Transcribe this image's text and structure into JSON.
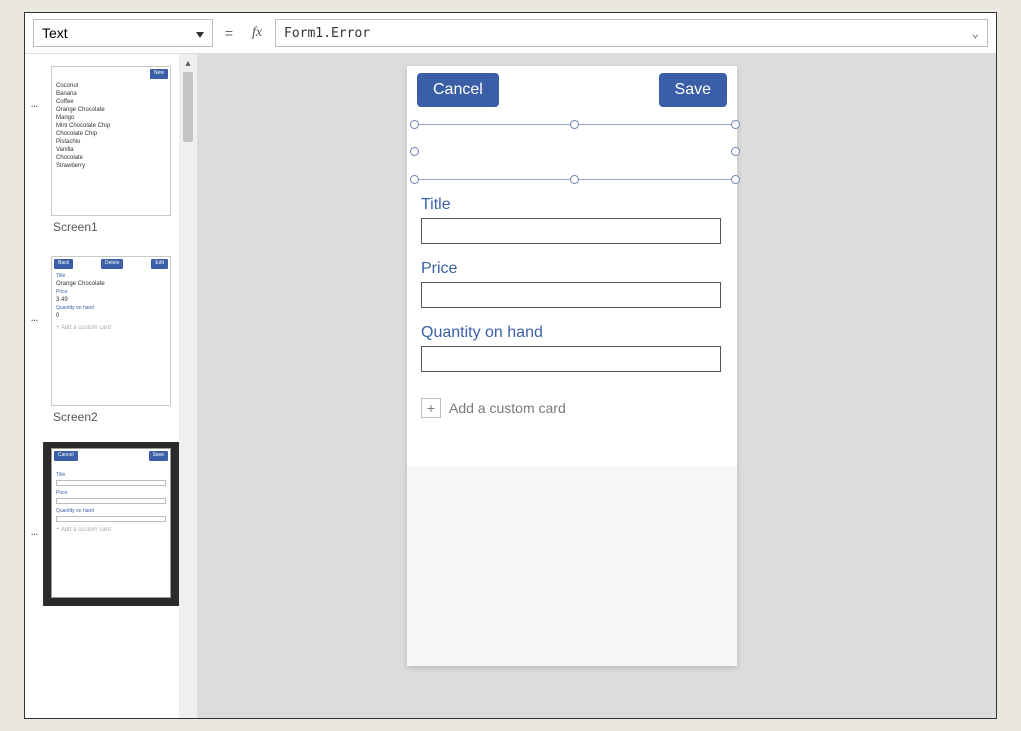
{
  "formulaBar": {
    "property": "Text",
    "equals": "=",
    "fx": "fx",
    "formula": "Form1.Error"
  },
  "thumbs": {
    "dots": "...",
    "screen1": {
      "label": "Screen1",
      "newBtn": "New",
      "items": [
        "Coconut",
        "Banana",
        "Coffee",
        "Orange Chocolate",
        "Mango",
        "Mint Chocolate Chip",
        "Chocolate Chip",
        "Pistachio",
        "Vanilla",
        "Chocolate",
        "Strawberry"
      ]
    },
    "screen2": {
      "label": "Screen2",
      "back": "Back",
      "delete": "Delete",
      "edit": "Edit",
      "titleLbl": "Title",
      "titleVal": "Orange Chocolate",
      "priceLbl": "Price",
      "priceVal": "3.49",
      "qtyLbl": "Quantity on hand",
      "qtyVal": "0",
      "addCard": "+  Add a custom card"
    },
    "screen3": {
      "cancel": "Cancel",
      "save": "Save",
      "titleLbl": "Title",
      "priceLbl": "Price",
      "qtyLbl": "Quantity on hand",
      "addCard": "+  Add a custom card"
    }
  },
  "phone": {
    "cancel": "Cancel",
    "save": "Save",
    "fields": {
      "title": "Title",
      "price": "Price",
      "qty": "Quantity on hand"
    },
    "addCard": "Add a custom card",
    "plus": "+"
  }
}
